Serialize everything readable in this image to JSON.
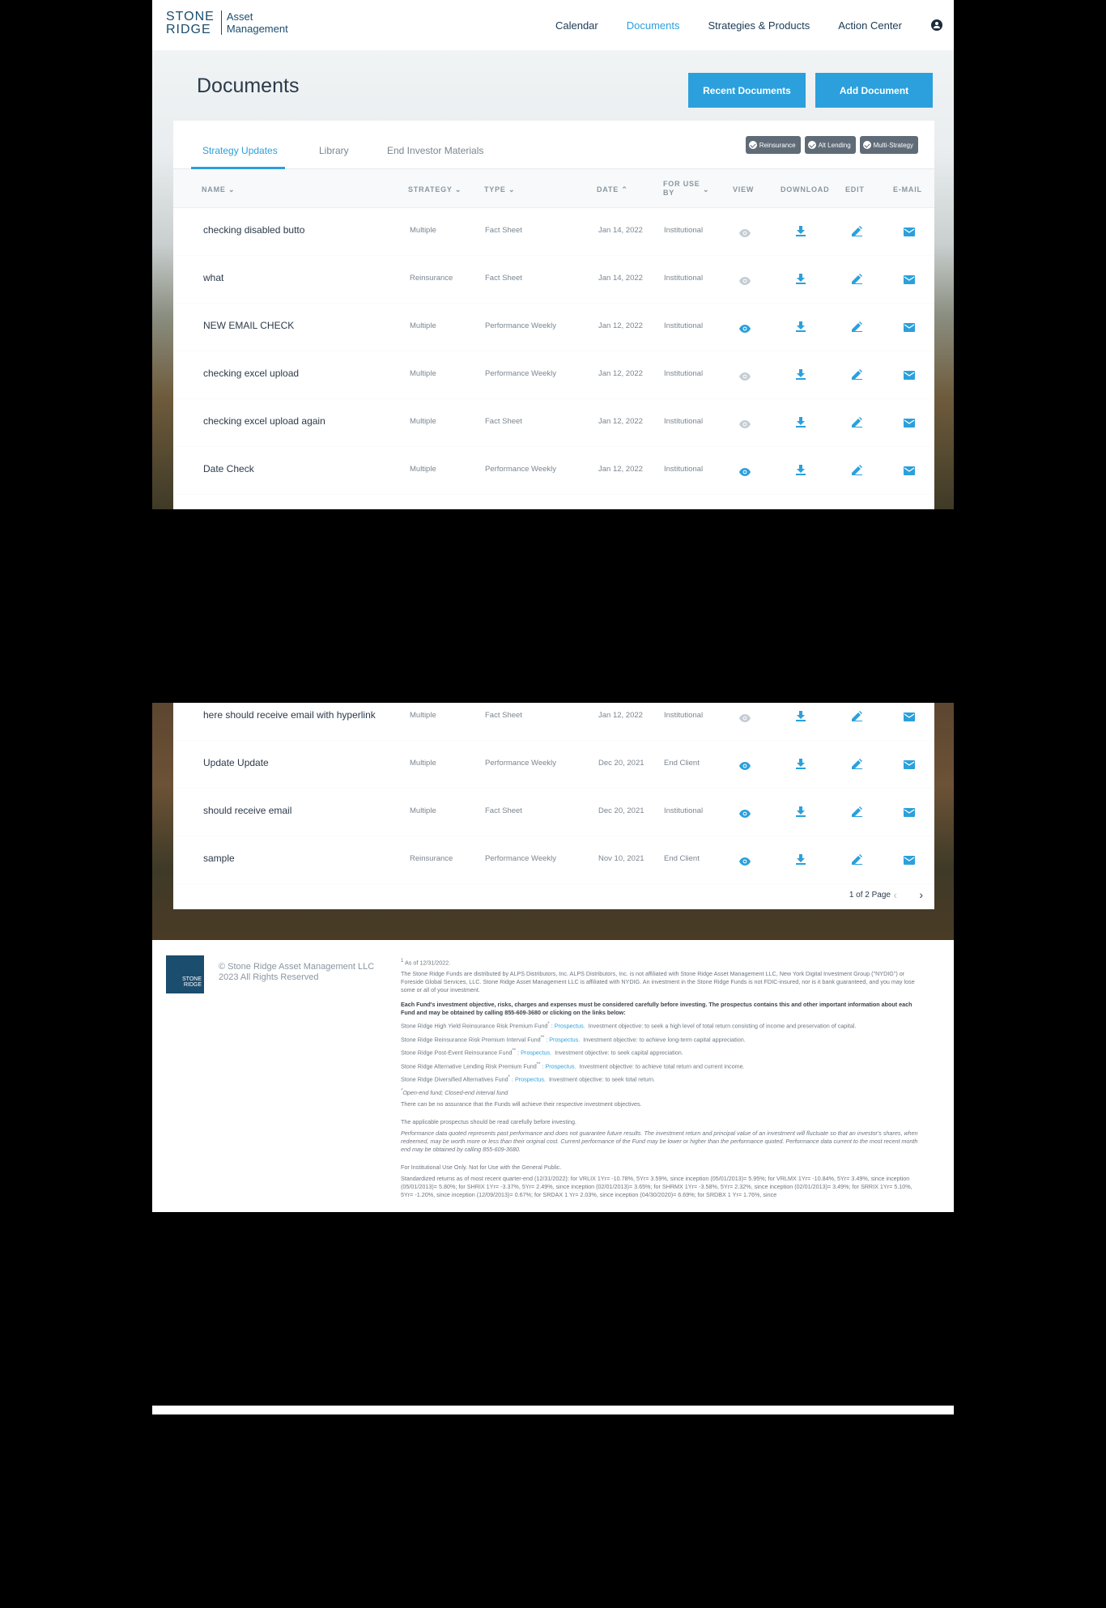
{
  "brand": {
    "logo_line1": "STONE",
    "logo_line2": "RIDGE",
    "logo_am1": "Asset",
    "logo_am2": "Management"
  },
  "nav": {
    "items": [
      "Calendar",
      "Documents",
      "Strategies & Products",
      "Action Center"
    ],
    "active": "Documents"
  },
  "page": {
    "title": "Documents"
  },
  "actions": {
    "recent": "Recent Documents",
    "add": "Add Document"
  },
  "tabs": [
    "Strategy Updates",
    "Library",
    "End Investor Materials"
  ],
  "filters": [
    "Reinsurance",
    "Alt Lending",
    "Multi-Strategy"
  ],
  "columns": {
    "name": "NAME",
    "strategy": "STRATEGY",
    "type": "TYPE",
    "date": "DATE",
    "for_use_by_1": "FOR USE",
    "for_use_by_2": "BY",
    "view": "VIEW",
    "download": "DOWNLOAD",
    "edit": "EDIT",
    "email": "E-MAIL"
  },
  "rows_top": [
    {
      "name": "checking disabled butto",
      "strategy": "Multiple",
      "type": "Fact Sheet",
      "date": "Jan 14, 2022",
      "use": "Institutional",
      "view_enabled": false
    },
    {
      "name": "what",
      "strategy": "Reinsurance",
      "type": "Fact Sheet",
      "date": "Jan 14, 2022",
      "use": "Institutional",
      "view_enabled": false
    },
    {
      "name": "NEW EMAIL CHECK",
      "strategy": "Multiple",
      "type": "Performance Weekly",
      "date": "Jan 12, 2022",
      "use": "Institutional",
      "view_enabled": true
    },
    {
      "name": "checking excel upload",
      "strategy": "Multiple",
      "type": "Performance Weekly",
      "date": "Jan 12, 2022",
      "use": "Institutional",
      "view_enabled": false
    },
    {
      "name": "checking excel upload again",
      "strategy": "Multiple",
      "type": "Fact Sheet",
      "date": "Jan 12, 2022",
      "use": "Institutional",
      "view_enabled": false
    },
    {
      "name": "Date Check",
      "strategy": "Multiple",
      "type": "Performance Weekly",
      "date": "Jan 12, 2022",
      "use": "Institutional",
      "view_enabled": true
    }
  ],
  "rows_bottom": [
    {
      "name": "here should receive email with hyperlink",
      "strategy": "Multiple",
      "type": "Fact Sheet",
      "date": "Jan 12, 2022",
      "use": "Institutional",
      "view_enabled": false
    },
    {
      "name": "Update Update",
      "strategy": "Multiple",
      "type": "Performance Weekly",
      "date": "Dec 20, 2021",
      "use": "End Client",
      "view_enabled": true
    },
    {
      "name": "should receive email",
      "strategy": "Multiple",
      "type": "Fact Sheet",
      "date": "Dec 20, 2021",
      "use": "Institutional",
      "view_enabled": true
    },
    {
      "name": "sample",
      "strategy": "Reinsurance",
      "type": "Performance Weekly",
      "date": "Nov 10, 2021",
      "use": "End Client",
      "view_enabled": true
    }
  ],
  "pagination": {
    "text": "1 of 2 Page"
  },
  "footer": {
    "copyright": "© Stone Ridge Asset Management LLC 2023 All Rights Reserved",
    "asof": "As of 12/31/2022.",
    "p1": "The Stone Ridge Funds are distributed by ALPS Distributors, Inc. ALPS Distributors, Inc. is not affiliated with Stone Ridge Asset Management LLC, New York Digital Investment Group (\"NYDIG\") or Foreside Global Services, LLC. Stone Ridge Asset Management LLC is affiliated with NYDIG. An investment in the Stone Ridge Funds is not FDIC-insured, nor is it bank guaranteed, and you may lose some or all of your investment.",
    "p2": "Each Fund's investment objective, risks, charges and expenses must be considered carefully before investing. The prospectus contains this and other important information about each Fund and may be obtained by calling 855-609-3680 or clicking on the links below:",
    "funds": [
      {
        "name": "Stone Ridge High Yield Reinsurance Risk Premium Fund",
        "mark": "*",
        "objective": "Investment objective: to seek a high level of total return consisting of income and preservation of capital."
      },
      {
        "name": "Stone Ridge Reinsurance Risk Premium Interval Fund",
        "mark": "**",
        "objective": "Investment objective: to achieve long-term capital appreciation."
      },
      {
        "name": "Stone Ridge Post-Event Reinsurance Fund",
        "mark": "**",
        "objective": "Investment objective: to seek capital appreciation."
      },
      {
        "name": "Stone Ridge Alternative Lending Risk Premium Fund",
        "mark": "**",
        "objective": "Investment objective: to achieve total return and current income."
      },
      {
        "name": "Stone Ridge Diversified Alternatives Fund",
        "mark": "*",
        "objective": "Investment objective: to seek total return."
      }
    ],
    "prospectus_label": "Prospectus.",
    "legend": "Open-end fund; Closed-end interval fund",
    "p3": "There can be no assurance that the Funds will achieve their respective investment objectives.",
    "p4": "The applicable prospectus should be read carefully before investing.",
    "p5": "Performance data quoted represents past performance and does not guarantee future results. The investment return and principal value of an investment will fluctuate so that an investor's shares, when redeemed, may be worth more or less than their original cost. Current performance of the Fund may be lower or higher than the performance quoted. Performance data current to the most recent month end may be obtained by calling 855-609-3680.",
    "p6": "For Institutional Use Only. Not for Use with the General Public.",
    "p7": "Standardized returns as of most recent quarter-end (12/31/2022): for VRLIX 1Yr= -10.78%, 5Yr= 3.59%, since inception (05/01/2013)= 5.95%; for VRLMX 1Yr= -10.84%, 5Yr= 3.49%, since inception (05/01/2013)= 5.80%; for SHRIX 1Yr= -3.37%, 5Yr= 2.49%, since inception (02/01/2013)= 3.65%; for SHRMX 1Yr= -3.58%, 5Yr= 2.32%, since inception (02/01/2013)= 3.49%; for SRRIX 1Yr= 5.10%, 5Yr= -1.20%, since inception (12/09/2013)= 0.67%; for SRDAX 1 Yr= 2.03%, since inception (04/30/2020)= 6.69%; for SRDBX 1 Yr= 1.76%, since"
  }
}
